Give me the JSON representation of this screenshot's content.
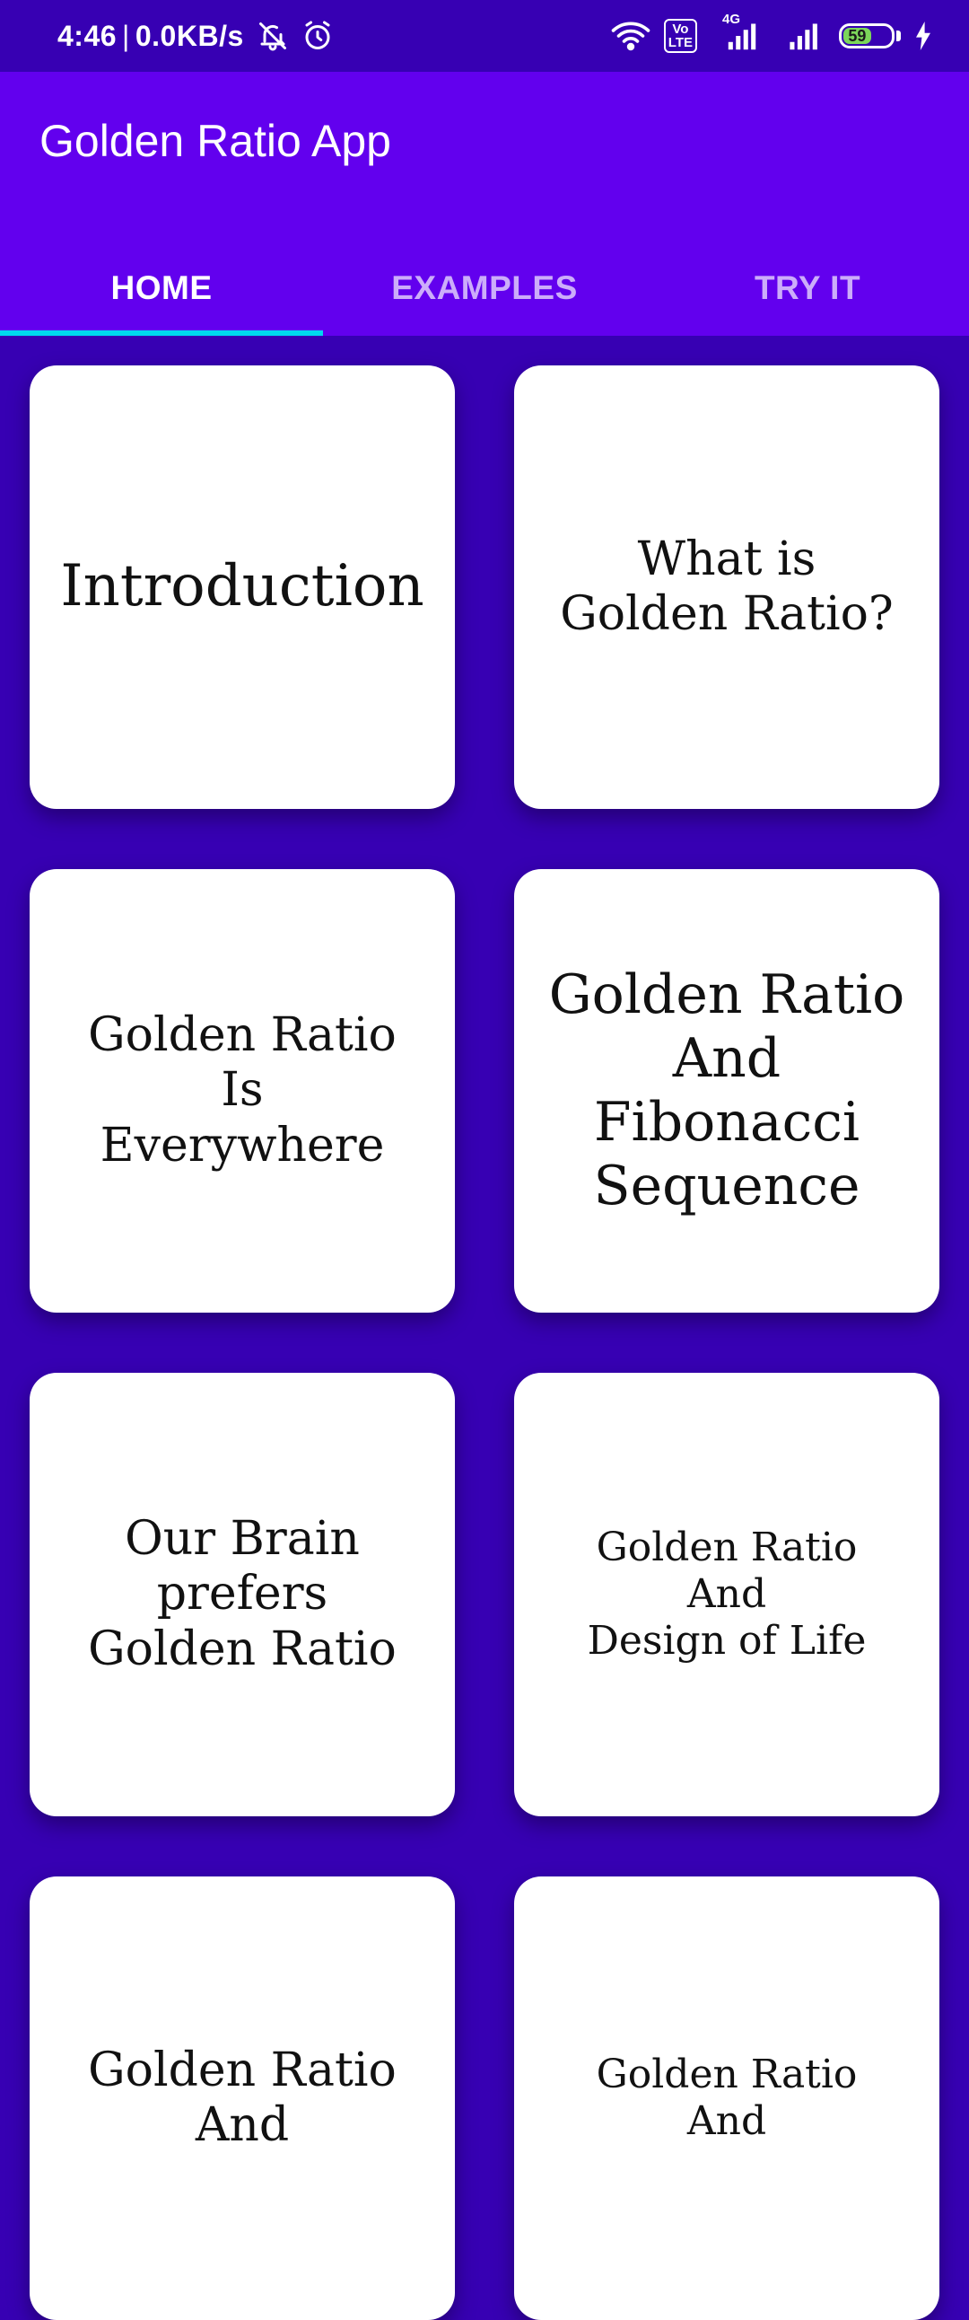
{
  "status_bar": {
    "time": "4:46",
    "separator": "|",
    "net_speed": "0.0KB/s",
    "network_4g": "4G",
    "volte_line1": "Vo",
    "volte_line2": "LTE",
    "battery_level": "59",
    "icons": [
      "notifications-muted-icon",
      "alarm-icon",
      "wifi-icon",
      "volte-icon",
      "signal-4g-icon",
      "signal-icon",
      "battery-icon",
      "charging-icon"
    ]
  },
  "app_bar": {
    "title": "Golden Ratio App",
    "background": "#6200EE"
  },
  "tabs": [
    {
      "label": "HOME",
      "active": true
    },
    {
      "label": "EXAMPLES",
      "active": false
    },
    {
      "label": "TRY IT",
      "active": false
    }
  ],
  "colors": {
    "background": "#3700B3",
    "tab_indicator": "#00D8F0",
    "card": "#FFFFFF"
  },
  "cards": [
    {
      "text": "Introduction"
    },
    {
      "text": "What is\nGolden Ratio?"
    },
    {
      "text": "Golden Ratio\nIs\nEverywhere"
    },
    {
      "text": "Golden Ratio\nAnd\nFibonacci\nSequence"
    },
    {
      "text": "Our Brain\nprefers\nGolden Ratio"
    },
    {
      "text": "Golden Ratio\nAnd\nDesign of Life"
    },
    {
      "text": "Golden Ratio\nAnd"
    },
    {
      "text": "Golden Ratio\nAnd"
    }
  ]
}
